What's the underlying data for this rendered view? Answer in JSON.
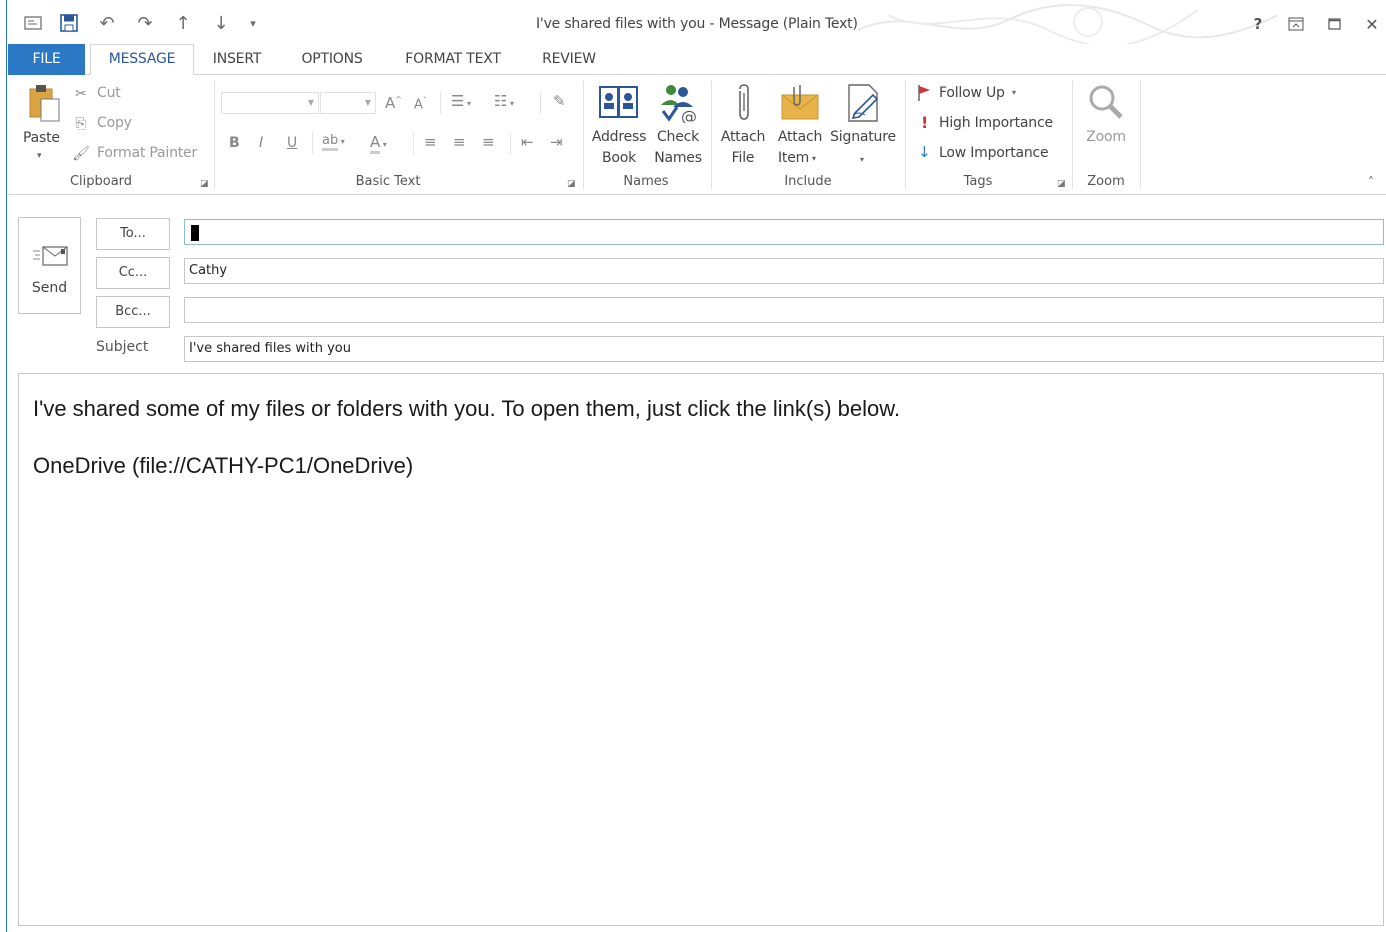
{
  "window": {
    "title": "I've shared files with you - Message (Plain Text)",
    "controls": [
      "help-icon",
      "ribbon-display-icon",
      "maximize-icon",
      "close-icon"
    ],
    "help_glyph": "?",
    "close_glyph": "✕"
  },
  "tabs": [
    {
      "label": "FILE"
    },
    {
      "label": "MESSAGE"
    },
    {
      "label": "INSERT"
    },
    {
      "label": "OPTIONS"
    },
    {
      "label": "FORMAT TEXT"
    },
    {
      "label": "REVIEW"
    }
  ],
  "ribbon": {
    "clipboard": {
      "label": "Clipboard",
      "paste": "Paste",
      "cut": "Cut",
      "copy": "Copy",
      "format_painter": "Format Painter"
    },
    "basic_text": {
      "label": "Basic Text",
      "bold": "B",
      "italic": "I",
      "underline": "U"
    },
    "names": {
      "label": "Names",
      "address_book_1": "Address",
      "address_book_2": "Book",
      "check_names_1": "Check",
      "check_names_2": "Names"
    },
    "include": {
      "label": "Include",
      "attach_file_1": "Attach",
      "attach_file_2": "File",
      "attach_item_1": "Attach",
      "attach_item_2": "Item",
      "signature": "Signature"
    },
    "tags": {
      "label": "Tags",
      "follow_up": "Follow Up",
      "high_importance": "High Importance",
      "low_importance": "Low Importance"
    },
    "zoom": {
      "label": "Zoom",
      "zoom_button": "Zoom"
    }
  },
  "compose": {
    "send": "Send",
    "to_button": "To...",
    "cc_button": "Cc...",
    "bcc_button": "Bcc...",
    "subject_label": "Subject",
    "to_value": "",
    "cc_value": "Cathy",
    "bcc_value": "",
    "subject_value": "I've shared files with you",
    "body_line1": "I've shared some of my files or folders with you. To open them, just click the link(s) below.",
    "body_line2": "OneDrive (file://CATHY-PC1/OneDrive)"
  },
  "colors": {
    "accent": "#2b79c5",
    "tab_active_text": "#2b579a",
    "flag_red": "#d13438",
    "low_importance_blue": "#2b79c5"
  }
}
